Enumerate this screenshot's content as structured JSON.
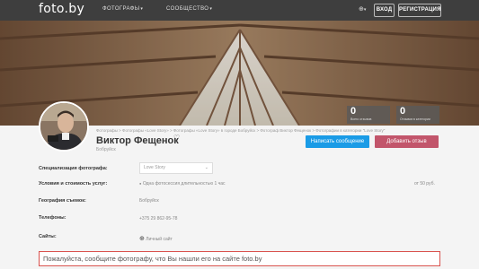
{
  "header": {
    "logo": "foto.by",
    "nav": [
      "ФОТОГРАФЫ",
      "СООБЩЕСТВО"
    ],
    "lang_icon": "globe-icon",
    "login_label": "ВХОД",
    "register_label": "РЕГИСТРАЦИЯ"
  },
  "stats": [
    {
      "value": "0",
      "label": "Всего отзывов"
    },
    {
      "value": "0",
      "label": "Отзывов в категории"
    }
  ],
  "profile": {
    "breadcrumb": "Фотографы > Фотографы «Love Story» > Фотографы «Love Story» в городе Бобруйск > Фотограф Виктор Фещенок > Фотографии в категории \"Love Story\"",
    "name": "Виктор Фещенок",
    "city": "Бобруйск",
    "message_button": "Написать сообщение",
    "review_button": "Добавить отзыв"
  },
  "details": {
    "specialization_label": "Специализация фотографа:",
    "specialization_value": "Love Story",
    "conditions_label": "Условия и стоимость услуг:",
    "conditions_value": "Одна фотосессия длительностью 1 час",
    "price": "от 50 руб.",
    "geography_label": "География съемок:",
    "geography_value": "Бобруйск",
    "phones_label": "Телефоны:",
    "phone": "+375 29 862-95-78",
    "sites_label": "Сайты:",
    "site": "Личный сайт"
  },
  "notice": "Пожалуйста, сообщите фотографу, что Вы нашли его на сайте foto.by",
  "colors": {
    "accent_blue": "#1a9be6",
    "accent_red": "#c2556b",
    "topbar": "#3e3e3e"
  }
}
